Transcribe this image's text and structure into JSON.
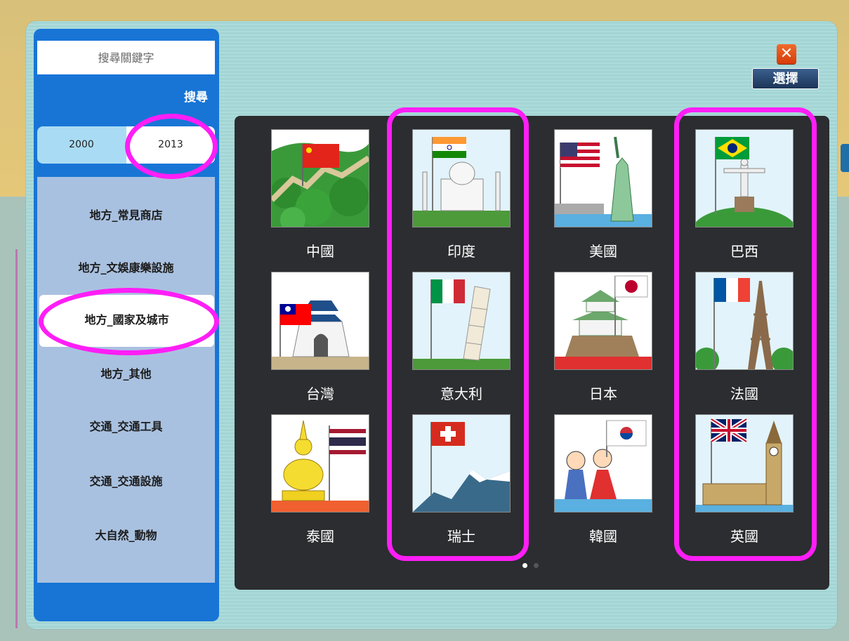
{
  "search": {
    "placeholder": "搜尋關鍵字",
    "button_label": "搜尋"
  },
  "year_tabs": [
    {
      "label": "2000",
      "selected": false
    },
    {
      "label": "2013",
      "selected": true
    }
  ],
  "categories": [
    {
      "label": "地方_常見商店",
      "selected": false
    },
    {
      "label": "地方_文娛康樂設施",
      "selected": false
    },
    {
      "label": "地方_國家及城市",
      "selected": true
    },
    {
      "label": "地方_其他",
      "selected": false
    },
    {
      "label": "交通_交通工具",
      "selected": false
    },
    {
      "label": "交通_交通設施",
      "selected": false
    },
    {
      "label": "大自然_動物",
      "selected": false
    }
  ],
  "header": {
    "close_icon": "close-icon",
    "select_label": "選擇"
  },
  "gallery": {
    "items": [
      {
        "label": "中國",
        "icon": "great-wall-china-flag"
      },
      {
        "label": "印度",
        "icon": "taj-mahal-india-flag"
      },
      {
        "label": "美國",
        "icon": "statue-of-liberty-us-flag"
      },
      {
        "label": "巴西",
        "icon": "christ-redeemer-brazil-flag"
      },
      {
        "label": "台灣",
        "icon": "memorial-hall-taiwan-flag"
      },
      {
        "label": "意大利",
        "icon": "leaning-tower-italy-flag"
      },
      {
        "label": "日本",
        "icon": "castle-japan-flag"
      },
      {
        "label": "法國",
        "icon": "eiffel-tower-france-flag"
      },
      {
        "label": "泰國",
        "icon": "buddha-thailand-flag"
      },
      {
        "label": "瑞士",
        "icon": "alps-switzerland-flag"
      },
      {
        "label": "韓國",
        "icon": "hanbok-children-korea-flag"
      },
      {
        "label": "英國",
        "icon": "big-ben-uk-flag"
      }
    ],
    "page_count": 2,
    "current_page": 1
  },
  "colors": {
    "highlight": "#ff1ef6",
    "sidebar": "#1875d6",
    "gallery_bg": "#2b2d30"
  }
}
